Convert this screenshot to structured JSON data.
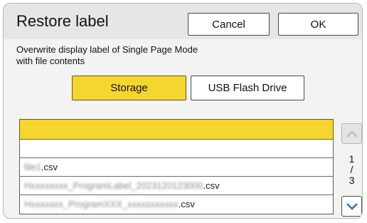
{
  "dialog": {
    "title": "Restore label",
    "cancel_label": "Cancel",
    "ok_label": "OK",
    "description_line1": "Overwrite display label of Single Page Mode",
    "description_line2": "with file contents"
  },
  "source": {
    "storage_label": "Storage",
    "usb_label": "USB Flash Drive",
    "selected": "Storage",
    "accent_color": "#f5d530"
  },
  "file_list": {
    "rows": [
      {
        "name": "",
        "selected": true
      },
      {
        "name": "",
        "selected": false
      },
      {
        "name_prefix": "file1",
        "name_suffix": ".csv",
        "selected": false
      },
      {
        "name_prefix": "Hxxxxxxxx_ProgramLabel_2023120123000",
        "name_suffix": ".csv",
        "selected": false
      },
      {
        "name_prefix": "Hxxxxxxx_ProgramXXX_xxxxxxxxxxx",
        "name_suffix": ".csv",
        "selected": false
      }
    ]
  },
  "pagination": {
    "current": "1",
    "separator": "/",
    "total": "3",
    "up_icon": "chevron-up-icon",
    "down_icon": "chevron-down-icon"
  }
}
